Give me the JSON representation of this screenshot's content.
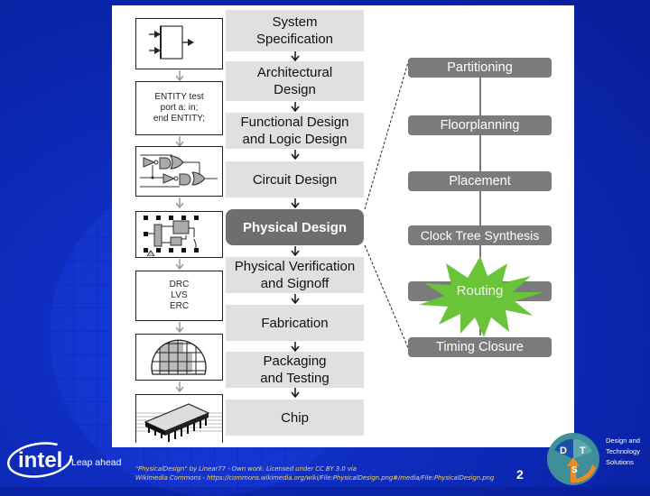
{
  "slide": {
    "page_number": "2",
    "colors": {
      "background": "#0b24a8",
      "center_box": "#e0e0e0",
      "highlight_box": "#6e6e6e",
      "right_box": "#7b7b7b",
      "routing_star": "#6ac43a",
      "caption": "#f2d36a"
    }
  },
  "diagram": {
    "left_column": {
      "entity_code": [
        "ENTITY test",
        "port a: in;",
        "end ENTITY;"
      ],
      "checks": [
        "DRC",
        "LVS",
        "ERC"
      ],
      "icons": [
        "block-diagram-icon",
        "vhdl-code",
        "logic-gates-icon",
        "layout-icon",
        "verification-checks",
        "wafer-icon",
        "chip-package-icon"
      ]
    },
    "center_column": [
      {
        "label_lines": [
          "System",
          "Specification"
        ]
      },
      {
        "label_lines": [
          "Architectural",
          "Design"
        ]
      },
      {
        "label_lines": [
          "Functional Design",
          "and Logic Design"
        ]
      },
      {
        "label_lines": [
          "Circuit Design"
        ]
      },
      {
        "label_lines": [
          "Physical Design"
        ],
        "highlighted": true
      },
      {
        "label_lines": [
          "Physical Verification",
          "and Signoff"
        ]
      },
      {
        "label_lines": [
          "Fabrication"
        ]
      },
      {
        "label_lines": [
          "Packaging",
          "and Testing"
        ]
      },
      {
        "label_lines": [
          "Chip"
        ]
      }
    ],
    "right_column": [
      {
        "label": "Partitioning"
      },
      {
        "label": "Floorplanning"
      },
      {
        "label": "Placement"
      },
      {
        "label": "Clock Tree Synthesis"
      },
      {
        "label": "Routing",
        "emphasized": true
      },
      {
        "label": "Timing Closure"
      }
    ]
  },
  "footer": {
    "caption_line1": "\"PhysicalDesign\" by Linear77 - Own work. Licensed under CC BY 3.0 via",
    "caption_line2": "Wikimedia Commons - https://commons.wikimedia.org/wiki/File:PhysicalDesign.png#/media/File:PhysicalDesign.png",
    "intel_logo_text": "intel",
    "intel_tagline": "Leap ahead",
    "dts_letters": [
      "D",
      "T",
      "S"
    ],
    "dts_lines": [
      "Design and",
      "Technology",
      "Solutions"
    ]
  }
}
